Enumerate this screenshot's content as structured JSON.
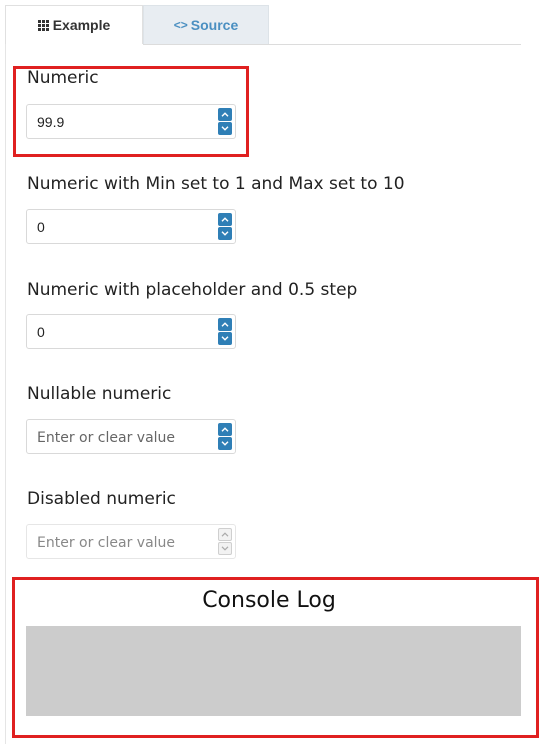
{
  "tabs": {
    "example_label": "Example",
    "source_label": "Source",
    "example_icon": "grid-icon",
    "source_icon": "code-icon"
  },
  "fields": [
    {
      "label": "Numeric",
      "value": "99.9",
      "placeholder": "",
      "disabled": false
    },
    {
      "label": "Numeric with Min set to 1 and Max set to 10",
      "value": "0",
      "placeholder": "",
      "disabled": false
    },
    {
      "label": "Numeric with placeholder and 0.5 step",
      "value": "0",
      "placeholder": "",
      "disabled": false
    },
    {
      "label": "Nullable numeric",
      "value": "",
      "placeholder": "Enter or clear value",
      "disabled": false
    },
    {
      "label": "Disabled numeric",
      "value": "",
      "placeholder": "Enter or clear value",
      "disabled": true
    }
  ],
  "console": {
    "title": "Console Log"
  },
  "colors": {
    "accent": "#2f7fb6",
    "highlight": "#e02020",
    "console_bg": "#cccccc",
    "source_tab": "#4a8fc1"
  }
}
